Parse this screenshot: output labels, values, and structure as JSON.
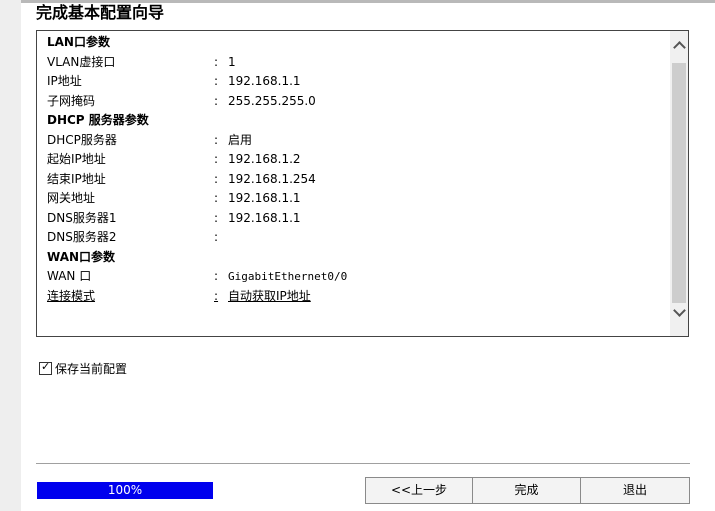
{
  "title": "完成基本配置向导",
  "summary": {
    "sections": [
      {
        "heading": "LAN口参数",
        "rows": [
          {
            "key": "VLAN虚接口",
            "value": "1"
          },
          {
            "key": "IP地址",
            "value": "192.168.1.1"
          },
          {
            "key": "子网掩码",
            "value": "255.255.255.0"
          }
        ]
      },
      {
        "heading": "DHCP 服务器参数",
        "rows": [
          {
            "key": "DHCP服务器",
            "value": "启用"
          },
          {
            "key": "起始IP地址",
            "value": "192.168.1.2"
          },
          {
            "key": "结束IP地址",
            "value": "192.168.1.254"
          },
          {
            "key": "网关地址",
            "value": "192.168.1.1"
          },
          {
            "key": "DNS服务器1",
            "value": "192.168.1.1"
          },
          {
            "key": "DNS服务器2",
            "value": ""
          }
        ]
      },
      {
        "heading": "WAN口参数",
        "rows": [
          {
            "key": "WAN 口",
            "value": "GigabitEthernet0/0"
          },
          {
            "key": "连接模式",
            "value": "自动获取IP地址"
          }
        ]
      }
    ],
    "colon": ":"
  },
  "save_option": {
    "label": "保存当前配置",
    "checked": true,
    "check_glyph": "✓"
  },
  "progress": {
    "percent": 100,
    "label": "100%"
  },
  "buttons": {
    "prev": "<<上一步",
    "finish": "完成",
    "exit": "退出"
  }
}
